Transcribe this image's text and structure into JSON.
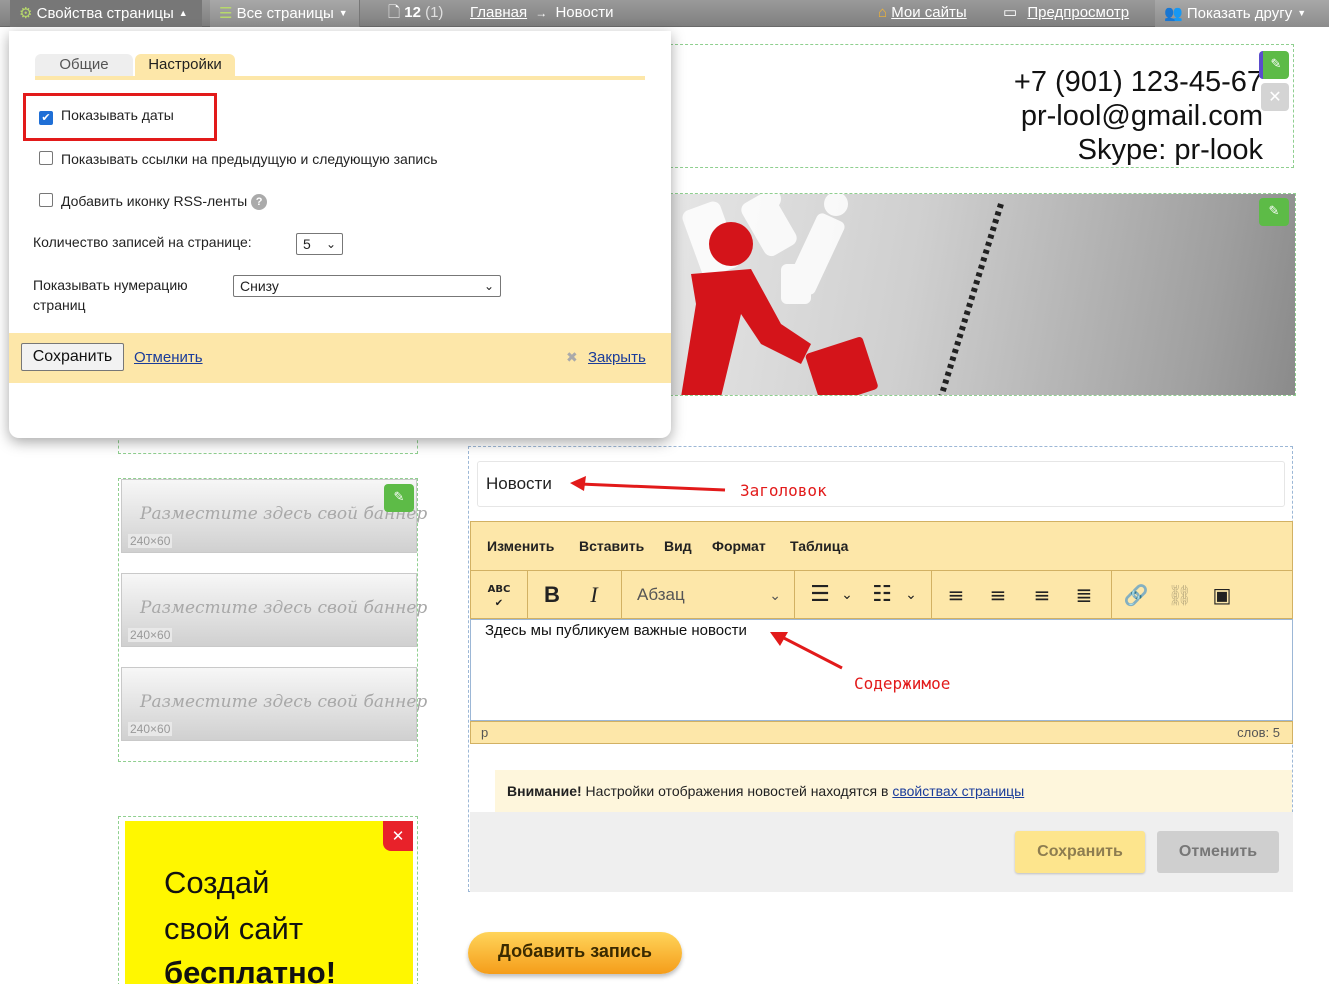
{
  "topbar": {
    "page_props": "Свойства страницы",
    "all_pages": "Все страницы",
    "page_count": "12",
    "page_count_paren": "(1)",
    "breadcrumb_home": "Главная",
    "breadcrumb_sep": "→",
    "breadcrumb_current": "Новости",
    "my_sites": "Мои сайты",
    "preview": "Предпросмотр",
    "show_friend": "Показать другу"
  },
  "header": {
    "phone": "+7 (901) 123-45-67",
    "email": "pr-lool@gmail.com",
    "skype": "Skype: pr-look"
  },
  "ads": {
    "slot_text": "Разместите здесь свой баннер",
    "slot_size": "240×60"
  },
  "promo": {
    "line1": "Создай",
    "line2": "свой сайт",
    "line3": "бесплатно!"
  },
  "news": {
    "title_value": "Новости",
    "menu": [
      "Изменить",
      "Вставить",
      "Вид",
      "Формат",
      "Таблица"
    ],
    "format_select": "Абзац",
    "content": "Здесь мы публикуем важные новости",
    "status_tag": "p",
    "word_count": "слов: 5",
    "notice_bold": "Внимание!",
    "notice_text": " Настройки отображения новостей находятся в ",
    "notice_link": "свойствах страницы",
    "save": "Сохранить",
    "cancel": "Отменить",
    "add_post": "Добавить запись"
  },
  "annotations": {
    "title": "Заголовок",
    "content": "Содержимое"
  },
  "popup": {
    "tab_general": "Общие",
    "tab_settings": "Настройки",
    "opt_show_dates": "Показывать даты",
    "opt_show_dates_checked": true,
    "opt_prev_next": "Показывать ссылки на предыдущую и следующую запись",
    "opt_rss": "Добавить иконку RSS-ленты",
    "per_page_label": "Количество записей на странице:",
    "per_page_value": "5",
    "pagination_label_1": "Показывать нумерацию",
    "pagination_label_2": "страниц",
    "pagination_value": "Снизу",
    "save": "Сохранить",
    "cancel": "Отменить",
    "close": "Закрыть"
  },
  "colors": {
    "accent_yellow": "#fde7a9",
    "highlight_red": "#e21a1a",
    "link_blue": "#1a3c9a",
    "edit_green": "#5dbb47"
  }
}
